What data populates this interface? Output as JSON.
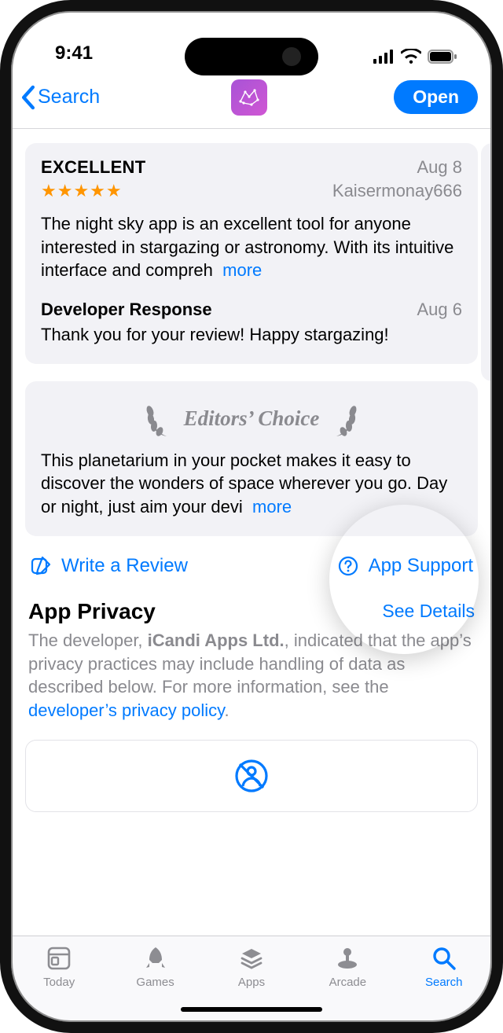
{
  "status": {
    "time": "9:41"
  },
  "nav": {
    "back_label": "Search",
    "open_label": "Open"
  },
  "review": {
    "title": "EXCELLENT",
    "date": "Aug 8",
    "author": "Kaisermonay666",
    "body": "The night sky app is an excellent tool for anyone interested in stargazing or astronomy. With its intuitive interface and compreh",
    "more": "more"
  },
  "dev_response": {
    "title": "Developer Response",
    "date": "Aug 6",
    "body": "Thank you for your review! Happy stargazing!"
  },
  "editors": {
    "title": "Editors’ Choice",
    "body": "This planetarium in your pocket makes it easy to discover the wonders of space wherever you go. Day or night, just aim your devi",
    "more": "more"
  },
  "actions": {
    "write_review": "Write a Review",
    "app_support": "App Support"
  },
  "privacy": {
    "title": "App Privacy",
    "see_details": "See Details",
    "text_prefix": "The developer, ",
    "developer": "iCandi Apps Ltd.",
    "text_mid": ", indicated that the app’s privacy practices may include handling of data as described below. For more information, see the ",
    "policy_link": "developer’s privacy policy",
    "text_suffix": "."
  },
  "tabs": {
    "today": "Today",
    "games": "Games",
    "apps": "Apps",
    "arcade": "Arcade",
    "search": "Search"
  },
  "colors": {
    "accent": "#007aff",
    "muted": "#8a8a8f"
  }
}
